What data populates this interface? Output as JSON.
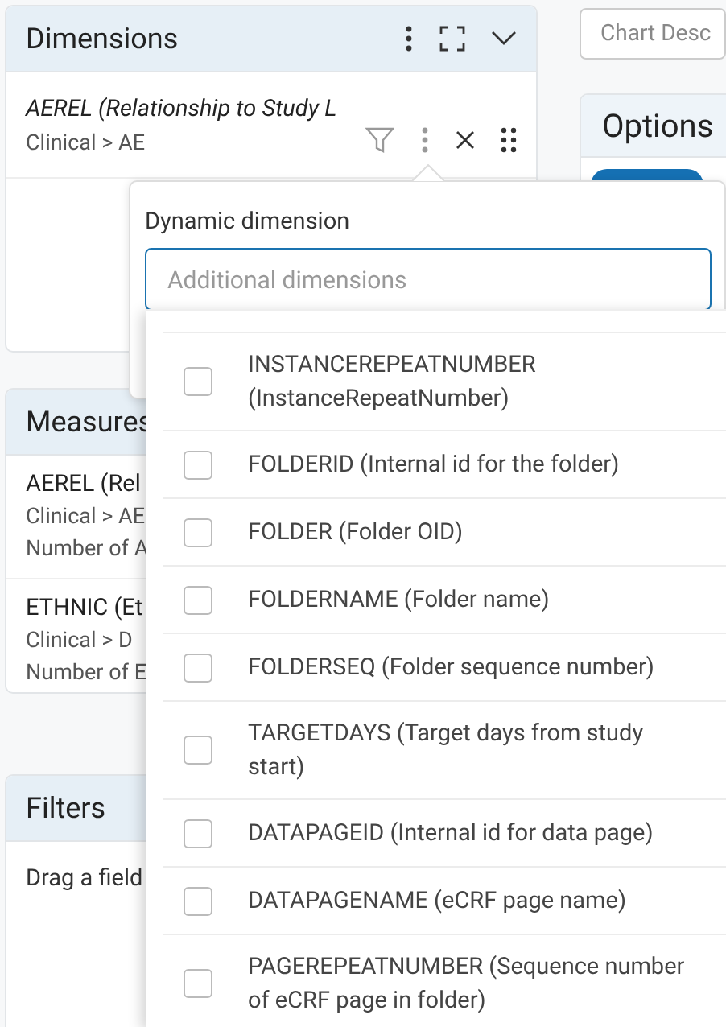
{
  "dimensions_panel": {
    "title": "Dimensions",
    "items": [
      {
        "title": "AEREL (Relationship to Study L",
        "path": "Clinical > AE"
      }
    ]
  },
  "measures_panel": {
    "title": "Measures",
    "items": [
      {
        "title": "AEREL (Rel",
        "path": "Clinical > AE",
        "detail": "Number of A"
      },
      {
        "title": "ETHNIC (Et",
        "path": "Clinical > D",
        "detail": "Number of E"
      }
    ]
  },
  "filters_panel": {
    "title": "Filters",
    "hint": "Drag a field"
  },
  "chart_description": {
    "placeholder": "Chart Desc"
  },
  "options_panel": {
    "title": "Options"
  },
  "dynamic_dimension_popover": {
    "label": "Dynamic dimension",
    "search": {
      "placeholder": "Additional dimensions"
    },
    "options": [
      {
        "label": "INSTANCEREPEATNUMBER (InstanceRepeatNumber)",
        "checked": false
      },
      {
        "label": "FOLDERID (Internal id for the folder)",
        "checked": false
      },
      {
        "label": "FOLDER (Folder OID)",
        "checked": false
      },
      {
        "label": "FOLDERNAME (Folder name)",
        "checked": false
      },
      {
        "label": "FOLDERSEQ (Folder sequence number)",
        "checked": false
      },
      {
        "label": "TARGETDAYS (Target days from study start)",
        "checked": false
      },
      {
        "label": "DATAPAGEID (Internal id for data page)",
        "checked": false
      },
      {
        "label": "DATAPAGENAME (eCRF page name)",
        "checked": false
      },
      {
        "label": "PAGEREPEATNUMBER (Sequence number of eCRF page in folder)",
        "checked": false
      }
    ]
  }
}
